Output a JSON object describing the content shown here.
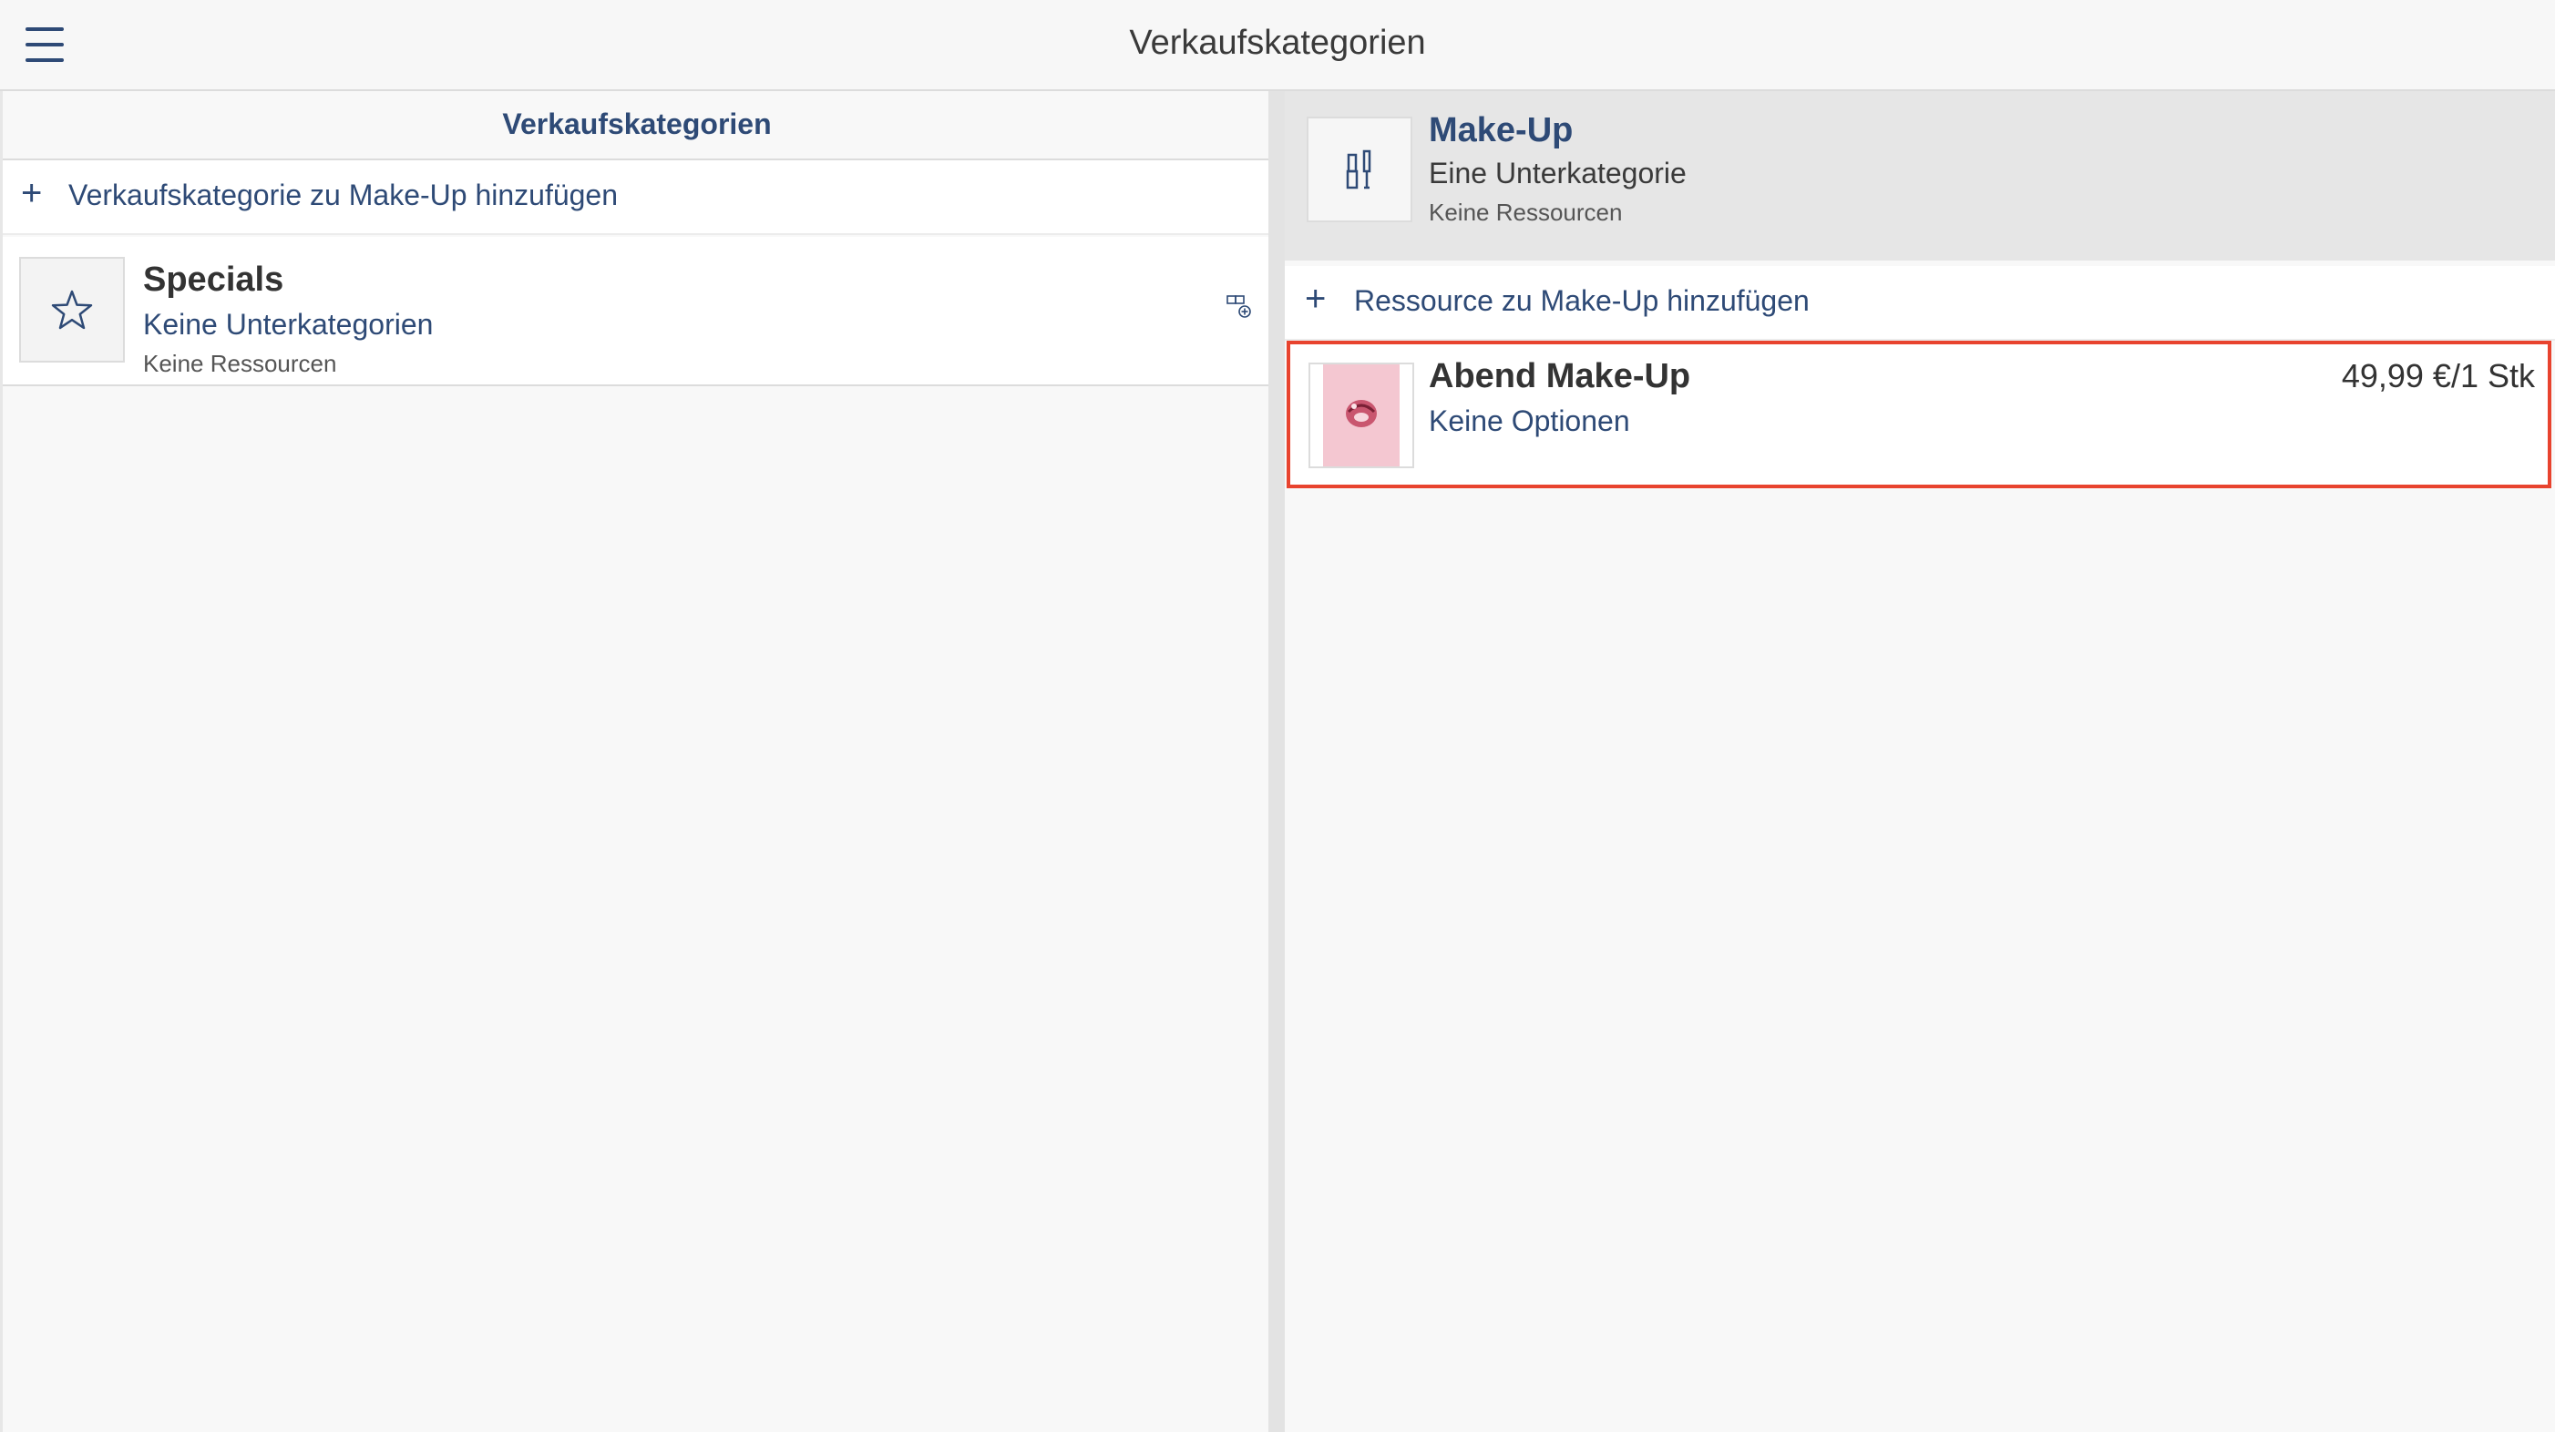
{
  "header": {
    "title": "Verkaufskategorien",
    "menu_icon": "hamburger-menu-icon"
  },
  "left_pane": {
    "title": "Verkaufskategorien",
    "add_label": "Verkaufskategorie zu Make-Up hinzufügen",
    "add_icon": "plus-icon",
    "categories": [
      {
        "name": "Specials",
        "subcategories": "Keine Unterkategorien",
        "resources": "Keine Ressourcen",
        "icon": "star-icon",
        "action_icon": "move-category-icon"
      }
    ]
  },
  "right_pane": {
    "category": {
      "name": "Make-Up",
      "subcategories": "Eine Unterkategorie",
      "resources": "Keine Ressourcen",
      "icon": "makeup-brushes-icon"
    },
    "add_label": "Ressource zu Make-Up hinzufügen",
    "add_icon": "plus-icon",
    "resources": [
      {
        "name": "Abend Make-Up",
        "options": "Keine Optionen",
        "price": "49,99 €/1 Stk",
        "highlight_color": "#e8432e"
      }
    ]
  },
  "colors": {
    "accent": "#2e4a76",
    "highlight": "#e8432e",
    "header_bg": "#e6e6e6",
    "page_bg": "#f8f8f8"
  }
}
